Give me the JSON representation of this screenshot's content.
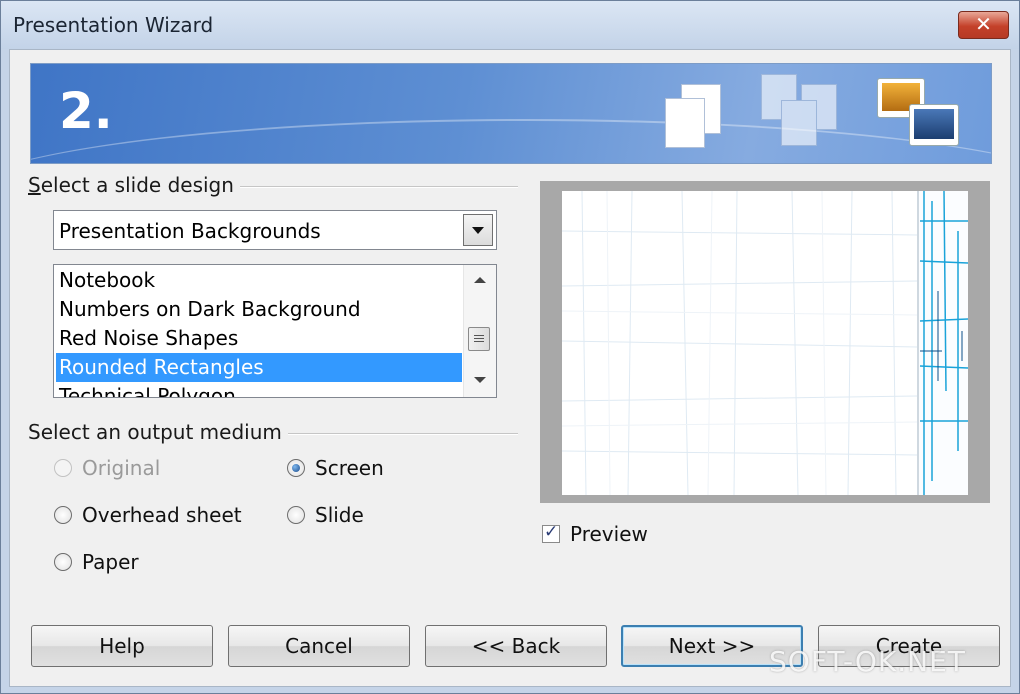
{
  "window": {
    "title": "Presentation Wizard",
    "close_glyph": "✕"
  },
  "banner": {
    "step": "2.",
    "icons": [
      "single-page-icon",
      "multi-page-icon",
      "image-slides-icon"
    ]
  },
  "design_section": {
    "label": "Select a slide design",
    "category": "Presentation Backgrounds",
    "items": [
      "Notebook",
      "Numbers on Dark Background",
      "Red Noise Shapes",
      "Rounded Rectangles",
      "Technical Polygon"
    ],
    "selected": "Rounded Rectangles"
  },
  "medium_section": {
    "label": "Select an output medium",
    "options": [
      {
        "label": "Original",
        "checked": false,
        "enabled": false
      },
      {
        "label": "Screen",
        "checked": true,
        "enabled": true
      },
      {
        "label": "Overhead sheet",
        "checked": false,
        "enabled": true
      },
      {
        "label": "Slide",
        "checked": false,
        "enabled": true
      },
      {
        "label": "Paper",
        "checked": false,
        "enabled": true
      }
    ]
  },
  "preview": {
    "label": "Preview",
    "checked": true
  },
  "buttons": {
    "help": "Help",
    "cancel": "Cancel",
    "back": "<< Back",
    "next": "Next >>",
    "create": "Create"
  },
  "watermark": "SOFT-OK.NET",
  "colors": {
    "selection": "#3399ff",
    "banner": "#4f82cf",
    "default_button_border": "#3c7fb1"
  }
}
